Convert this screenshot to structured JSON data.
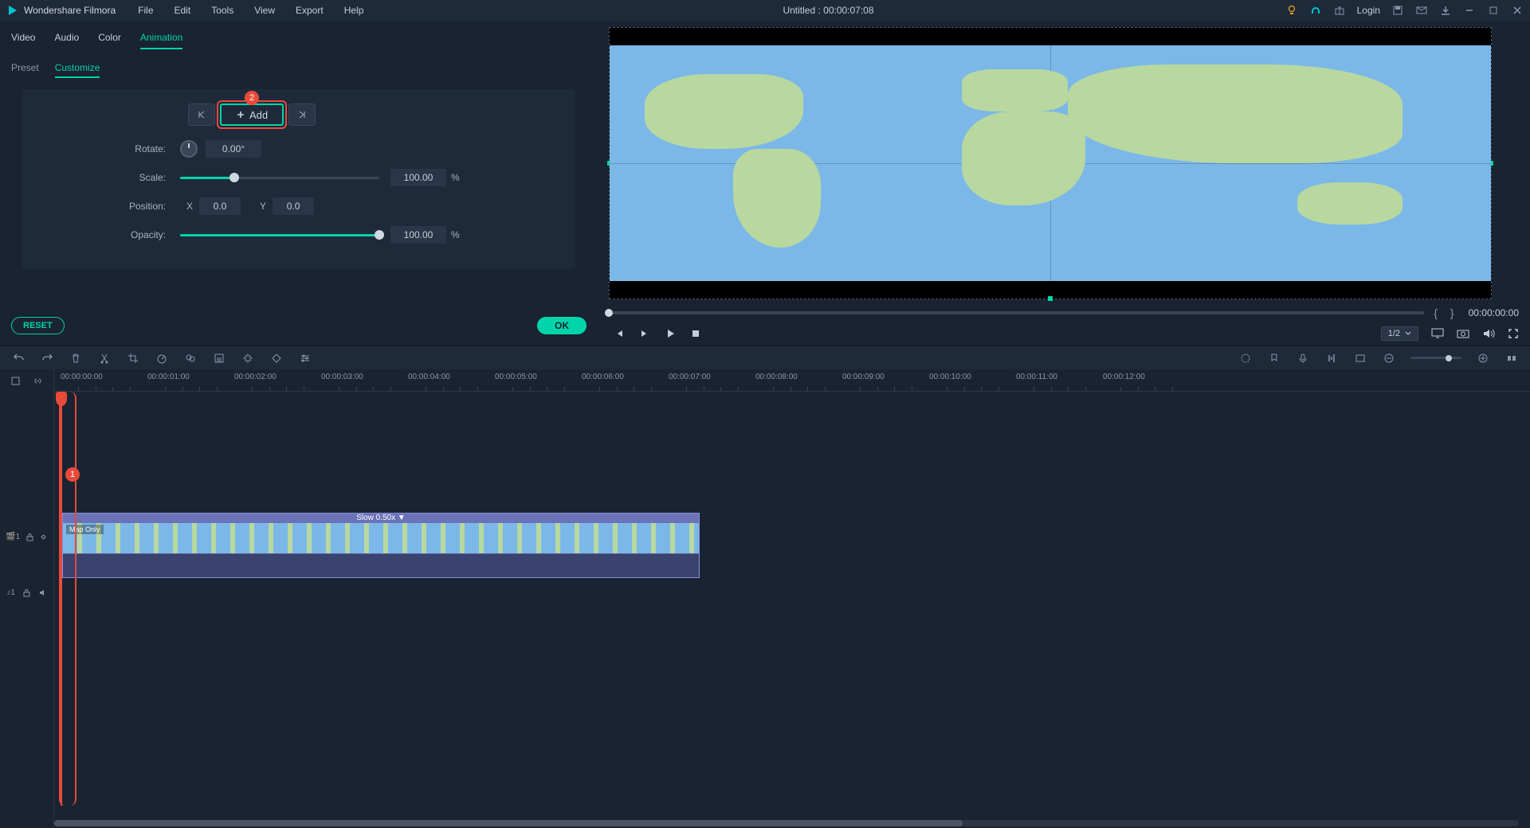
{
  "app": {
    "name": "Wondershare Filmora"
  },
  "menus": {
    "file": "File",
    "edit": "Edit",
    "tools": "Tools",
    "view": "View",
    "export": "Export",
    "help": "Help"
  },
  "title": {
    "project": "Untitled",
    "sep": " : ",
    "timecode": "00:00:07:08"
  },
  "header": {
    "login": "Login"
  },
  "categories": {
    "video": "Video",
    "audio": "Audio",
    "color": "Color",
    "animation": "Animation"
  },
  "subtabs": {
    "preset": "Preset",
    "customize": "Customize"
  },
  "keyframes": {
    "add": "Add",
    "badge": "2"
  },
  "props": {
    "rotate": {
      "label": "Rotate:",
      "value": "0.00°"
    },
    "scale": {
      "label": "Scale:",
      "value": "100.00",
      "suffix": "%",
      "percent": 27
    },
    "position": {
      "label": "Position:",
      "xlabel": "X",
      "x": "0.0",
      "ylabel": "Y",
      "y": "0.0"
    },
    "opacity": {
      "label": "Opacity:",
      "value": "100.00",
      "suffix": "%",
      "percent": 100
    }
  },
  "footer": {
    "reset": "RESET",
    "ok": "OK"
  },
  "preview": {
    "timecode": "00:00:00:00",
    "quality": "1/2"
  },
  "timeline": {
    "ticks": [
      "00:00:00:00",
      "00:00:01:00",
      "00:00:02:00",
      "00:00:03:00",
      "00:00:04:00",
      "00:00:05:00",
      "00:00:06:00",
      "00:00:07:00",
      "00:00:08:00",
      "00:00:09:00",
      "00:00:10:00",
      "00:00:11:00",
      "00:00:12:00"
    ],
    "clip": {
      "effect": "Slow 0.50x ▼",
      "name": "Map Only"
    },
    "badge1": "1",
    "trackV": "🎬1",
    "trackA": "♪1"
  }
}
